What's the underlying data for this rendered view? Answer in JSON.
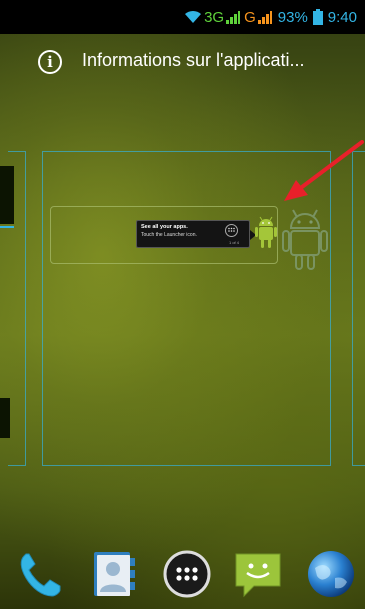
{
  "status_bar": {
    "network": "3G",
    "signal_g": "G",
    "battery": "93%",
    "time": "9:40"
  },
  "info_bar": {
    "icon": "info-icon",
    "text": "Informations sur l'applicati..."
  },
  "tooltip": {
    "title": "See all your apps.",
    "body": "Touch the Launcher icon.",
    "counter": "1 of 4"
  },
  "dock": {
    "items": [
      {
        "name": "phone-icon"
      },
      {
        "name": "contacts-icon"
      },
      {
        "name": "all-apps-icon"
      },
      {
        "name": "messaging-icon"
      },
      {
        "name": "browser-icon"
      }
    ]
  },
  "colors": {
    "accent": "#33b5e5",
    "signal_green": "#5fd23b",
    "signal_orange": "#f7941d",
    "android_green": "#a4c639",
    "arrow_red": "#e8202a"
  }
}
